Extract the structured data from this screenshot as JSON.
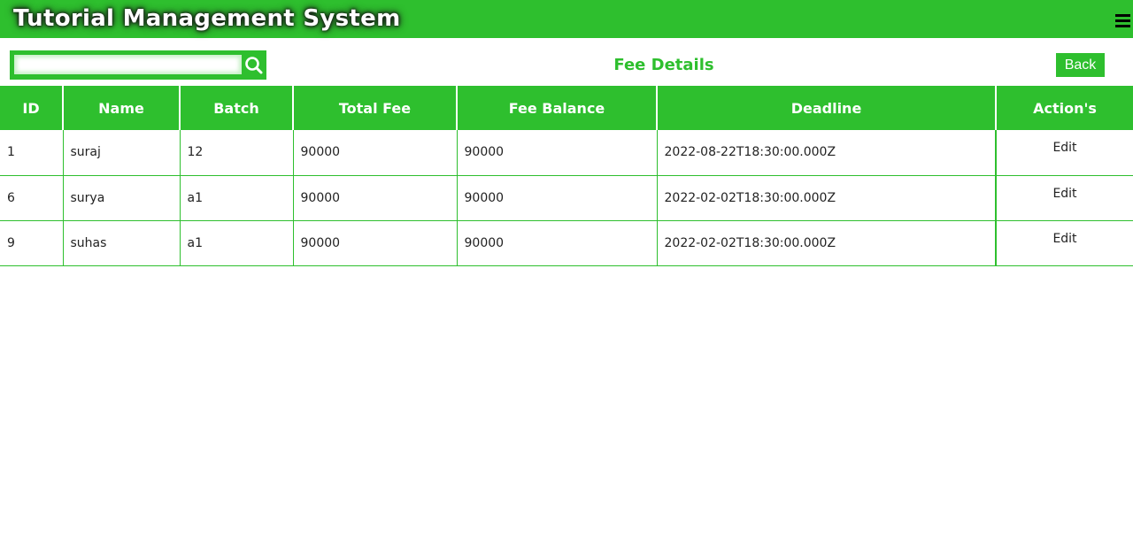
{
  "app": {
    "title": "Tutorial Management System"
  },
  "header": {
    "menu_icon": "hamburger-menu-icon",
    "background_color": "#2ebf2e"
  },
  "search": {
    "placeholder": "",
    "value": "",
    "icon": "search-icon"
  },
  "page": {
    "heading": "Fee Details",
    "back_label": "Back"
  },
  "table": {
    "columns": [
      "ID",
      "Name",
      "Batch",
      "Total Fee",
      "Fee Balance",
      "Deadline",
      "Action's"
    ],
    "rows": [
      {
        "id": "1",
        "name": "suraj",
        "batch": "12",
        "total_fee": "90000",
        "fee_balance": "90000",
        "deadline": "2022-08-22T18:30:00.000Z",
        "action": "Edit"
      },
      {
        "id": "6",
        "name": "surya",
        "batch": "a1",
        "total_fee": "90000",
        "fee_balance": "90000",
        "deadline": "2022-02-02T18:30:00.000Z",
        "action": "Edit"
      },
      {
        "id": "9",
        "name": "suhas",
        "batch": "a1",
        "total_fee": "90000",
        "fee_balance": "90000",
        "deadline": "2022-02-02T18:30:00.000Z",
        "action": "Edit"
      }
    ]
  },
  "colors": {
    "accent": "#2ebf2e",
    "text": "#222222",
    "background": "#ffffff"
  }
}
